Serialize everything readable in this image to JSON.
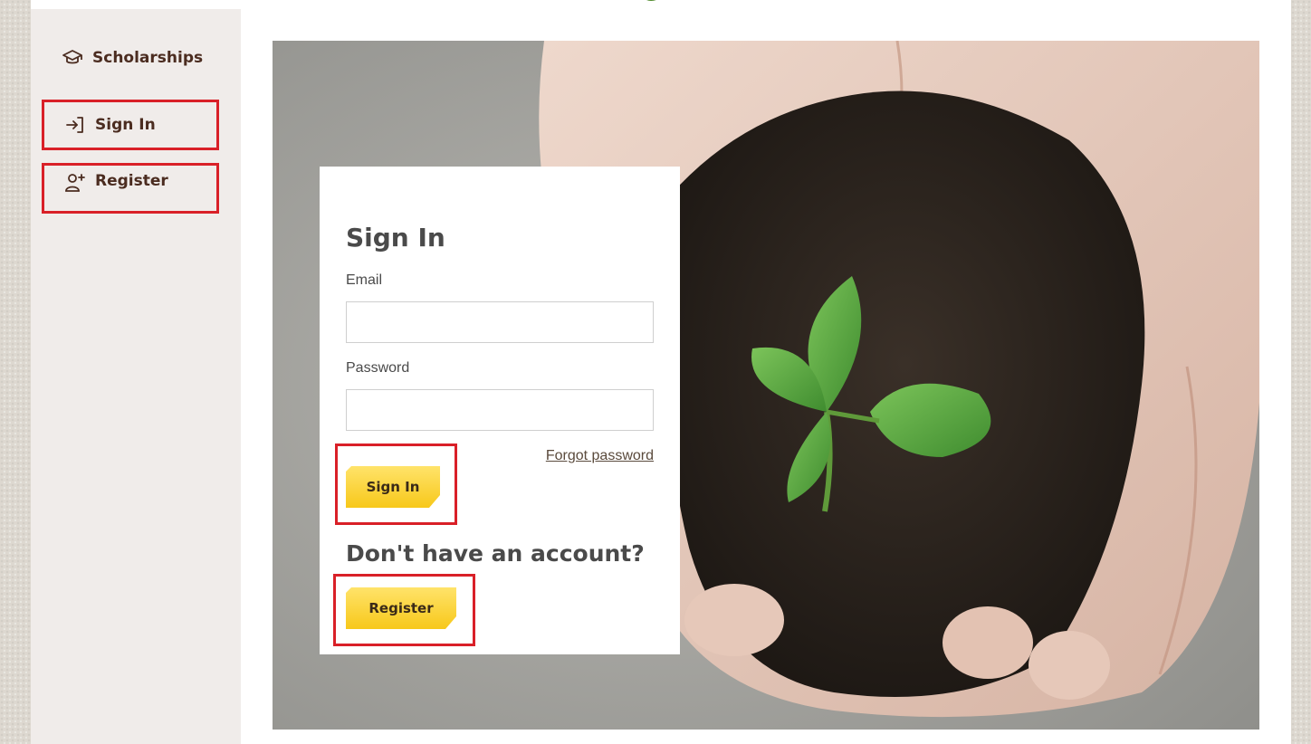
{
  "sidebar": {
    "items": [
      {
        "label": "Scholarships",
        "icon": "graduation-cap-icon"
      },
      {
        "label": "Sign In",
        "icon": "sign-in-arrow-icon"
      },
      {
        "label": "Register",
        "icon": "user-add-icon"
      }
    ]
  },
  "login_card": {
    "title": "Sign In",
    "email_label": "Email",
    "email_value": "",
    "password_label": "Password",
    "password_value": "",
    "forgot_link": "Forgot password",
    "sign_in_button": "Sign In",
    "no_account_heading": "Don't have an account?",
    "register_button": "Register"
  },
  "colors": {
    "brand_text": "#4b2c20",
    "button_yellow": "#f7c81a",
    "highlight_red": "#d92028",
    "sidebar_bg": "#f0ecea"
  }
}
